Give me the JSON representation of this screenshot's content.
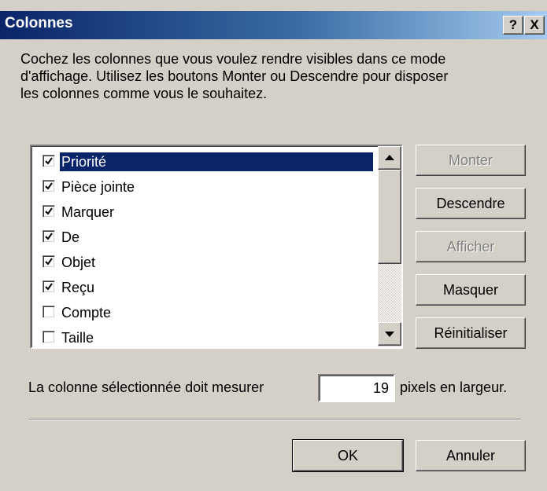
{
  "window": {
    "title": "Colonnes",
    "help_button": "?",
    "close_button": "X"
  },
  "description": {
    "lines": [
      "Cochez les colonnes que vous voulez rendre visibles dans ce mode",
      "d'affichage. Utilisez les boutons Monter ou Descendre pour disposer",
      "les colonnes comme vous le souhaitez."
    ]
  },
  "columns": {
    "items": [
      {
        "label": "Priorité",
        "checked": true,
        "selected": true
      },
      {
        "label": "Pièce jointe",
        "checked": true,
        "selected": false
      },
      {
        "label": "Marquer",
        "checked": true,
        "selected": false
      },
      {
        "label": "De",
        "checked": true,
        "selected": false
      },
      {
        "label": "Objet",
        "checked": true,
        "selected": false
      },
      {
        "label": "Reçu",
        "checked": true,
        "selected": false
      },
      {
        "label": "Compte",
        "checked": false,
        "selected": false
      },
      {
        "label": "Taille",
        "checked": false,
        "selected": false
      }
    ]
  },
  "buttons": {
    "monter": "Monter",
    "descendre": "Descendre",
    "afficher": "Afficher",
    "masquer": "Masquer",
    "reinitialiser": "Réinitialiser",
    "ok": "OK",
    "annuler": "Annuler"
  },
  "width": {
    "prefix": "La colonne sélectionnée doit mesurer",
    "value": "19",
    "suffix": "pixels en largeur."
  },
  "icons": {
    "check": "check-icon",
    "scroll_up": "up-arrow-icon",
    "scroll_down": "down-arrow-icon"
  },
  "colors": {
    "title_start": "#0a246a",
    "title_end": "#a6caf0",
    "selection": "#0a246a",
    "dialog_bg": "#d4d0c8"
  }
}
